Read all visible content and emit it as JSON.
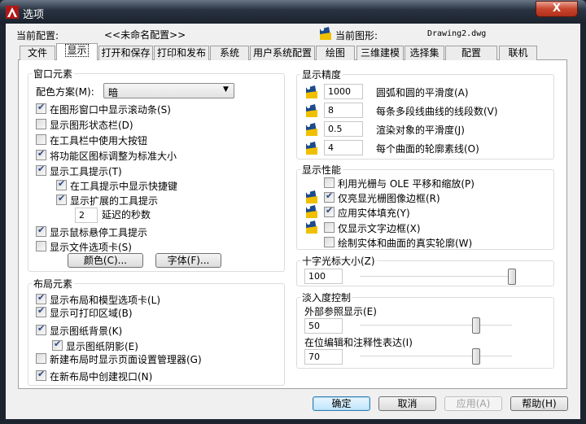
{
  "window": {
    "title": "选项",
    "close_label": "X"
  },
  "profile": {
    "label": "当前配置:",
    "value": "<<未命名配置>>",
    "drawing_label": "当前图形:",
    "drawing_value": "Drawing2.dwg"
  },
  "tabs": [
    "文件",
    "显示",
    "打开和保存",
    "打印和发布",
    "系统",
    "用户系统配置",
    "绘图",
    "三维建模",
    "选择集",
    "配置",
    "联机"
  ],
  "selected_tab": 1,
  "window_elements": {
    "title": "窗口元素",
    "color_scheme_label": "配色方案(M):",
    "color_scheme_value": "暗",
    "options": [
      {
        "label": "在图形窗口中显示滚动条(S)",
        "checked": true,
        "indent": 0
      },
      {
        "label": "显示图形状态栏(D)",
        "checked": false,
        "indent": 0
      },
      {
        "label": "在工具栏中使用大按钮",
        "checked": false,
        "indent": 0
      },
      {
        "label": "将功能区图标调整为标准大小",
        "checked": true,
        "indent": 0
      },
      {
        "label": "显示工具提示(T)",
        "checked": true,
        "indent": 0
      },
      {
        "label": "在工具提示中显示快捷键",
        "checked": true,
        "indent": 1
      },
      {
        "label": "显示扩展的工具提示",
        "checked": true,
        "indent": 1
      }
    ],
    "delay_value": "2",
    "delay_label": "延迟的秒数",
    "options2": [
      {
        "label": "显示鼠标悬停工具提示",
        "checked": true
      },
      {
        "label": "显示文件选项卡(S)",
        "checked": false
      }
    ],
    "colors_button": "颜色(C)...",
    "fonts_button": "字体(F)..."
  },
  "layout_elements": {
    "title": "布局元素",
    "options": [
      {
        "label": "显示布局和模型选项卡(L)",
        "checked": true,
        "indent": 0
      },
      {
        "label": "显示可打印区域(B)",
        "checked": true,
        "indent": 0
      },
      {
        "label": "显示图纸背景(K)",
        "checked": true,
        "indent": 0
      },
      {
        "label": "显示图纸阴影(E)",
        "checked": true,
        "indent": 1
      },
      {
        "label": "新建布局时显示页面设置管理器(G)",
        "checked": false,
        "indent": 0
      },
      {
        "label": "在新布局中创建视口(N)",
        "checked": true,
        "indent": 0
      }
    ]
  },
  "display_resolution": {
    "title": "显示精度",
    "items": [
      {
        "value": "1000",
        "label": "圆弧和圆的平滑度(A)"
      },
      {
        "value": "8",
        "label": "每条多段线曲线的线段数(V)"
      },
      {
        "value": "0.5",
        "label": "渲染对象的平滑度(J)"
      },
      {
        "value": "4",
        "label": "每个曲面的轮廓素线(O)"
      }
    ]
  },
  "display_performance": {
    "title": "显示性能",
    "options": [
      {
        "label": "利用光栅与 OLE 平移和缩放(P)",
        "checked": false,
        "icon": false
      },
      {
        "label": "仅亮显光栅图像边框(R)",
        "checked": true,
        "icon": true
      },
      {
        "label": "应用实体填充(Y)",
        "checked": true,
        "icon": true
      },
      {
        "label": "仅显示文字边框(X)",
        "checked": false,
        "icon": true
      },
      {
        "label": "绘制实体和曲面的真实轮廓(W)",
        "checked": false,
        "icon": false
      }
    ]
  },
  "crosshair": {
    "title": "十字光标大小(Z)",
    "value": "100",
    "slider_percent": 100
  },
  "fade": {
    "title": "淡入度控制",
    "xref_label": "外部参照显示(E)",
    "xref_value": "50",
    "xref_slider_percent": 76,
    "inplace_label": "在位编辑和注释性表达(I)",
    "inplace_value": "70",
    "inplace_slider_percent": 76
  },
  "buttons": {
    "ok": "确定",
    "cancel": "取消",
    "apply": "应用(A)",
    "help": "帮助(H)"
  }
}
